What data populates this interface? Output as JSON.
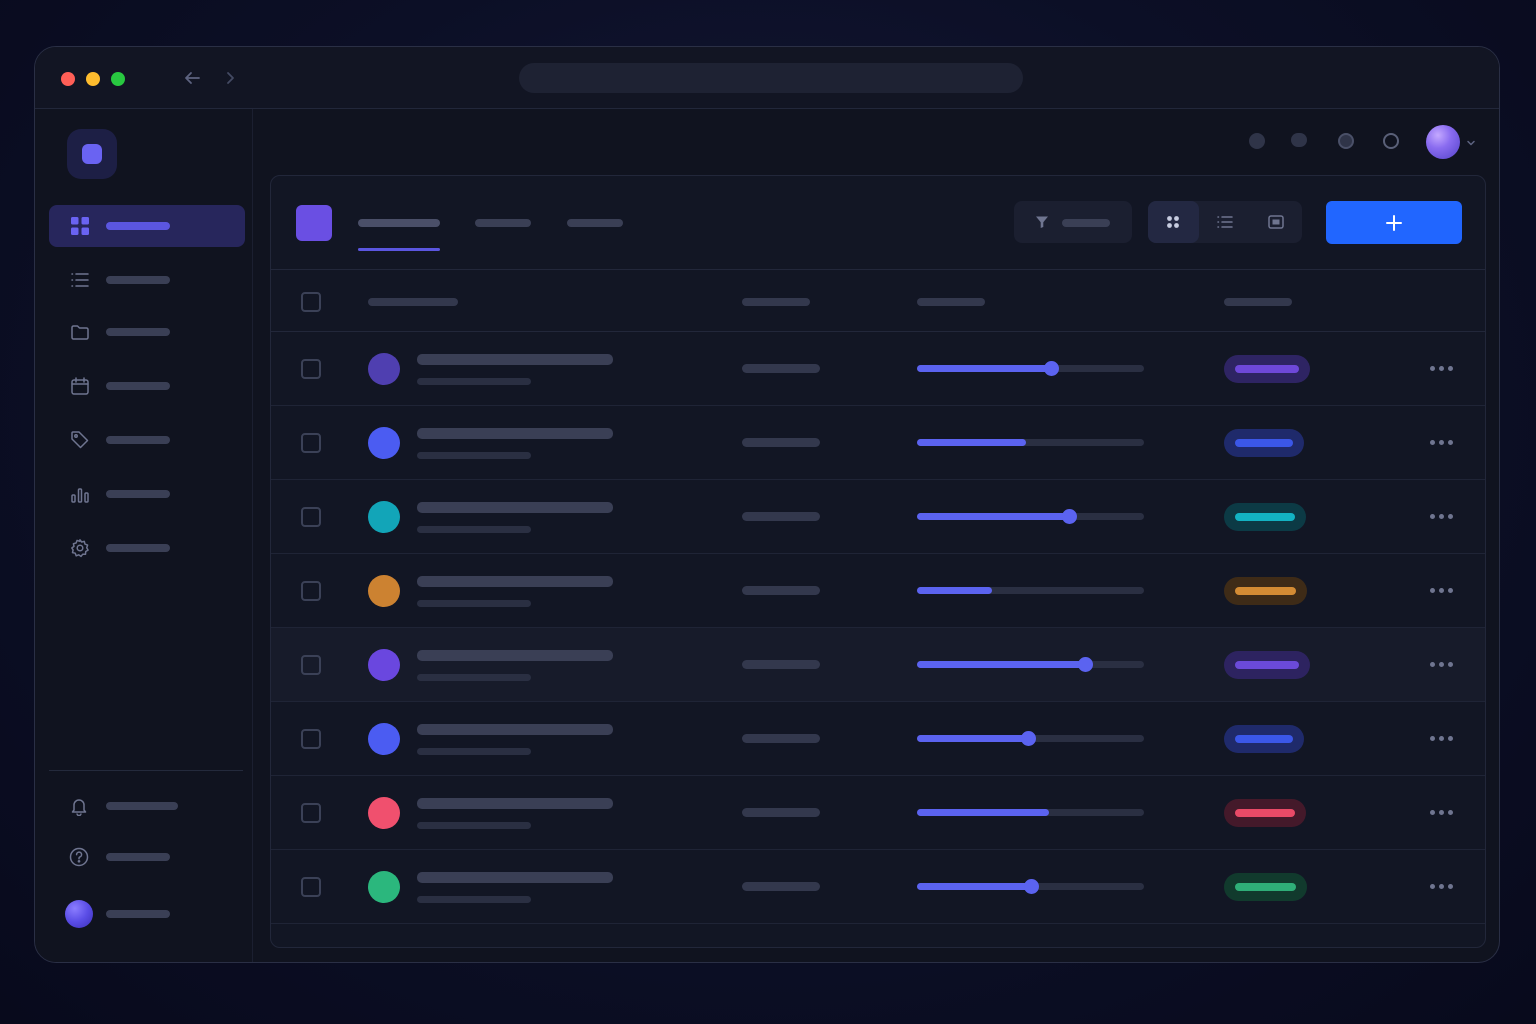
{
  "window": {
    "traffic_lights": [
      "#ff5f57",
      "#febc2e",
      "#28c840"
    ],
    "back_icon": "arrow-left-icon",
    "forward_icon": "chevron-right-icon"
  },
  "sidebar": {
    "logo_icon": "app-logo-icon",
    "accent": "#6a63f2",
    "items": [
      {
        "icon": "grid-icon",
        "active": true
      },
      {
        "icon": "list-icon",
        "active": false
      },
      {
        "icon": "folder-icon",
        "active": false
      },
      {
        "icon": "calendar-icon",
        "active": false
      },
      {
        "icon": "tag-icon",
        "active": false
      },
      {
        "icon": "bar-chart-icon",
        "active": false
      },
      {
        "icon": "gear-icon",
        "active": false
      }
    ],
    "bottom_items": [
      {
        "icon": "bell-icon"
      },
      {
        "icon": "help-icon"
      },
      {
        "icon": "avatar"
      }
    ]
  },
  "toolbar": {
    "add_label": "+",
    "add_color": "#2166ff",
    "filter_icon": "filter-icon",
    "view_icons": [
      "grid-view-icon",
      "list-view-icon",
      "card-view-icon"
    ]
  },
  "rows": [
    {
      "avatar_color": "#4f3fb0",
      "progress": 0.59,
      "knob": true,
      "status_bg": "#2e2463",
      "status_fg": "#6e48d8",
      "status_w": 86
    },
    {
      "avatar_color": "#4b5cf2",
      "progress": 0.48,
      "knob": false,
      "status_bg": "#1f2a6b",
      "status_fg": "#3b57e8",
      "status_w": 80
    },
    {
      "avatar_color": "#12a5b8",
      "progress": 0.67,
      "knob": true,
      "status_bg": "#0c3a45",
      "status_fg": "#13b3c3",
      "status_w": 82
    },
    {
      "avatar_color": "#cc8231",
      "progress": 0.33,
      "knob": false,
      "status_bg": "#3e2b17",
      "status_fg": "#d38b34",
      "status_w": 83
    },
    {
      "avatar_color": "#6a47df",
      "progress": 0.74,
      "knob": true,
      "status_bg": "#2d2360",
      "status_fg": "#6b4ad9",
      "status_w": 86
    },
    {
      "avatar_color": "#4b5cf2",
      "progress": 0.49,
      "knob": true,
      "status_bg": "#1f2a6b",
      "status_fg": "#3b57e8",
      "status_w": 80
    },
    {
      "avatar_color": "#f0506e",
      "progress": 0.58,
      "knob": false,
      "status_bg": "#44192a",
      "status_fg": "#e94a67",
      "status_w": 82
    },
    {
      "avatar_color": "#2bb77d",
      "progress": 0.5,
      "knob": true,
      "status_bg": "#113a2d",
      "status_fg": "#2fae78",
      "status_w": 83
    }
  ]
}
